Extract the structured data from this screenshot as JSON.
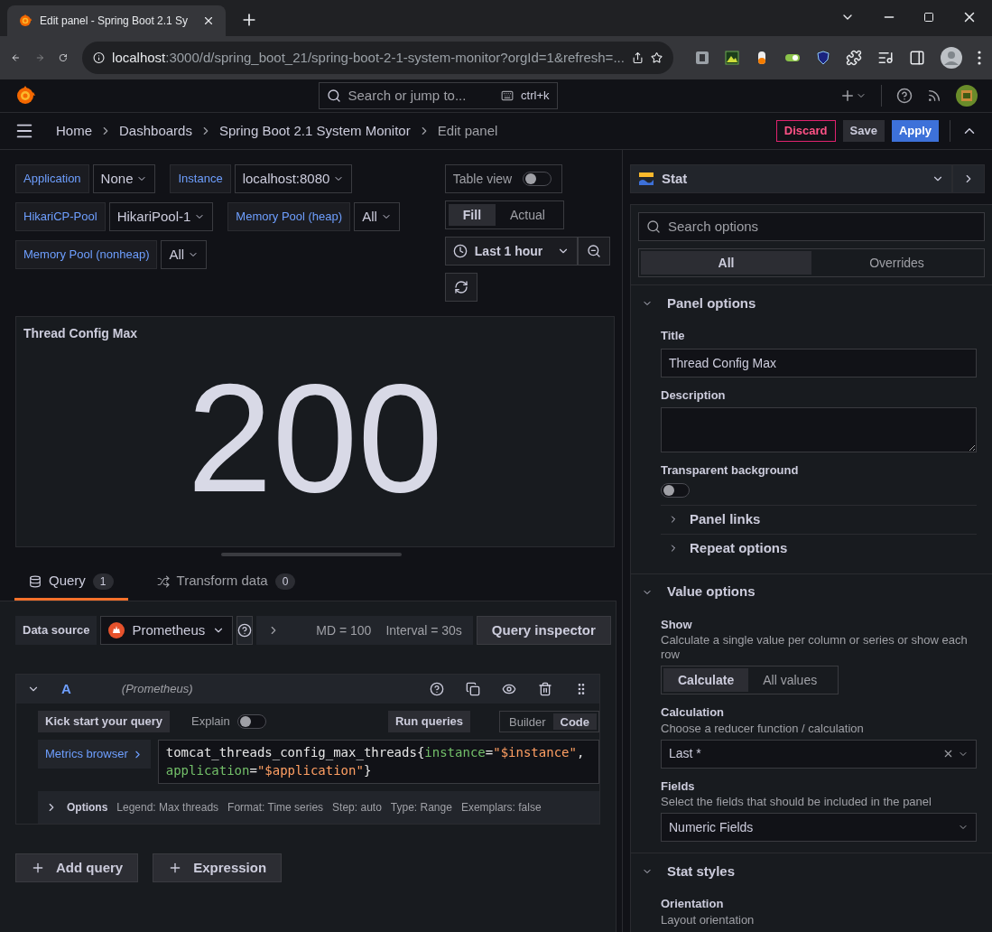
{
  "browser": {
    "tab_title": "Edit panel - Spring Boot 2.1 Sy",
    "url_host": "localhost",
    "url_path": ":3000/d/spring_boot_21/spring-boot-2-1-system-monitor?orgId=1&refresh=..."
  },
  "topbar": {
    "search_placeholder": "Search or jump to...",
    "shortcut": "ctrl+k"
  },
  "breadcrumbs": [
    {
      "label": "Home",
      "current": false
    },
    {
      "label": "Dashboards",
      "current": false
    },
    {
      "label": "Spring Boot 2.1 System Monitor",
      "current": false
    },
    {
      "label": "Edit panel",
      "current": true
    }
  ],
  "actions": [
    {
      "label": "Discard",
      "kind": "danger"
    },
    {
      "label": "Save",
      "kind": "secondary"
    },
    {
      "label": "Apply",
      "kind": "primary"
    }
  ],
  "variables": [
    [
      {
        "label": "Application",
        "value": "None"
      },
      {
        "label": "Instance",
        "value": "localhost:8080"
      }
    ],
    [
      {
        "label": "HikariCP-Pool",
        "value": "HikariPool-1"
      },
      {
        "label": "Memory Pool (heap)",
        "value": "All"
      }
    ],
    [
      {
        "label": "Memory Pool (nonheap)",
        "value": "All"
      }
    ]
  ],
  "table_view": {
    "label": "Table view",
    "on": false
  },
  "size_modes": [
    {
      "label": "Fill",
      "selected": true
    },
    {
      "label": "Actual",
      "selected": false
    }
  ],
  "time_range": "Last 1 hour",
  "panel": {
    "title": "Thread Config Max",
    "value": "200"
  },
  "query_tabs": [
    {
      "label": "Query",
      "count": "1",
      "selected": true,
      "kind": "query"
    },
    {
      "label": "Transform data",
      "count": "0",
      "selected": false,
      "kind": "transform"
    }
  ],
  "datasource": {
    "label": "Data source",
    "name": "Prometheus",
    "md": "MD = 100",
    "interval": "Interval = 30s",
    "inspector": "Query inspector"
  },
  "query": {
    "ref": "A",
    "source": "(Prometheus)",
    "expanded": true,
    "kick_start": "Kick start your query",
    "explain": {
      "label": "Explain",
      "on": false
    },
    "run": "Run queries",
    "modes": [
      {
        "label": "Builder",
        "selected": false
      },
      {
        "label": "Code",
        "selected": true
      }
    ],
    "metrics_browser": "Metrics browser",
    "code": [
      {
        "text": "tomcat_threads_config_max_threads{",
        "kind": "plain"
      },
      {
        "text": "instance",
        "kind": "label"
      },
      {
        "text": "=",
        "kind": "plain"
      },
      {
        "text": "\"$instance\"",
        "kind": "string"
      },
      {
        "text": ", ",
        "kind": "plain"
      },
      {
        "text": "application",
        "kind": "label"
      },
      {
        "text": "=",
        "kind": "plain"
      },
      {
        "text": "\"$application\"",
        "kind": "string"
      },
      {
        "text": "}",
        "kind": "plain"
      }
    ],
    "options_label": "Options",
    "options": [
      "Legend: Max threads",
      "Format: Time series",
      "Step: auto",
      "Type: Range",
      "Exemplars: false"
    ]
  },
  "add_buttons": [
    "Add query",
    "Expression"
  ],
  "viz": {
    "name": "Stat"
  },
  "options_search_placeholder": "Search options",
  "option_tabs": [
    {
      "label": "All",
      "selected": true
    },
    {
      "label": "Overrides",
      "selected": false
    }
  ],
  "panel_options": {
    "title": "Panel options",
    "expanded": true,
    "title_label": "Title",
    "title_value": "Thread Config Max",
    "description_label": "Description",
    "transparent": {
      "label": "Transparent background",
      "on": false
    },
    "subsections": [
      {
        "title": "Panel links",
        "expanded": false
      },
      {
        "title": "Repeat options",
        "expanded": false
      }
    ]
  },
  "value_options": {
    "title": "Value options",
    "expanded": true,
    "show_label": "Show",
    "show_desc": "Calculate a single value per column or series or show each row",
    "show_modes": [
      {
        "label": "Calculate",
        "selected": true
      },
      {
        "label": "All values",
        "selected": false
      }
    ],
    "calc_label": "Calculation",
    "calc_desc": "Choose a reducer function / calculation",
    "calc_value": "Last *",
    "fields_label": "Fields",
    "fields_desc": "Select the fields that should be included in the panel",
    "fields_value": "Numeric Fields"
  },
  "stat_styles": {
    "title": "Stat styles",
    "expanded": true,
    "orientation_label": "Orientation",
    "orientation_desc": "Layout orientation"
  }
}
